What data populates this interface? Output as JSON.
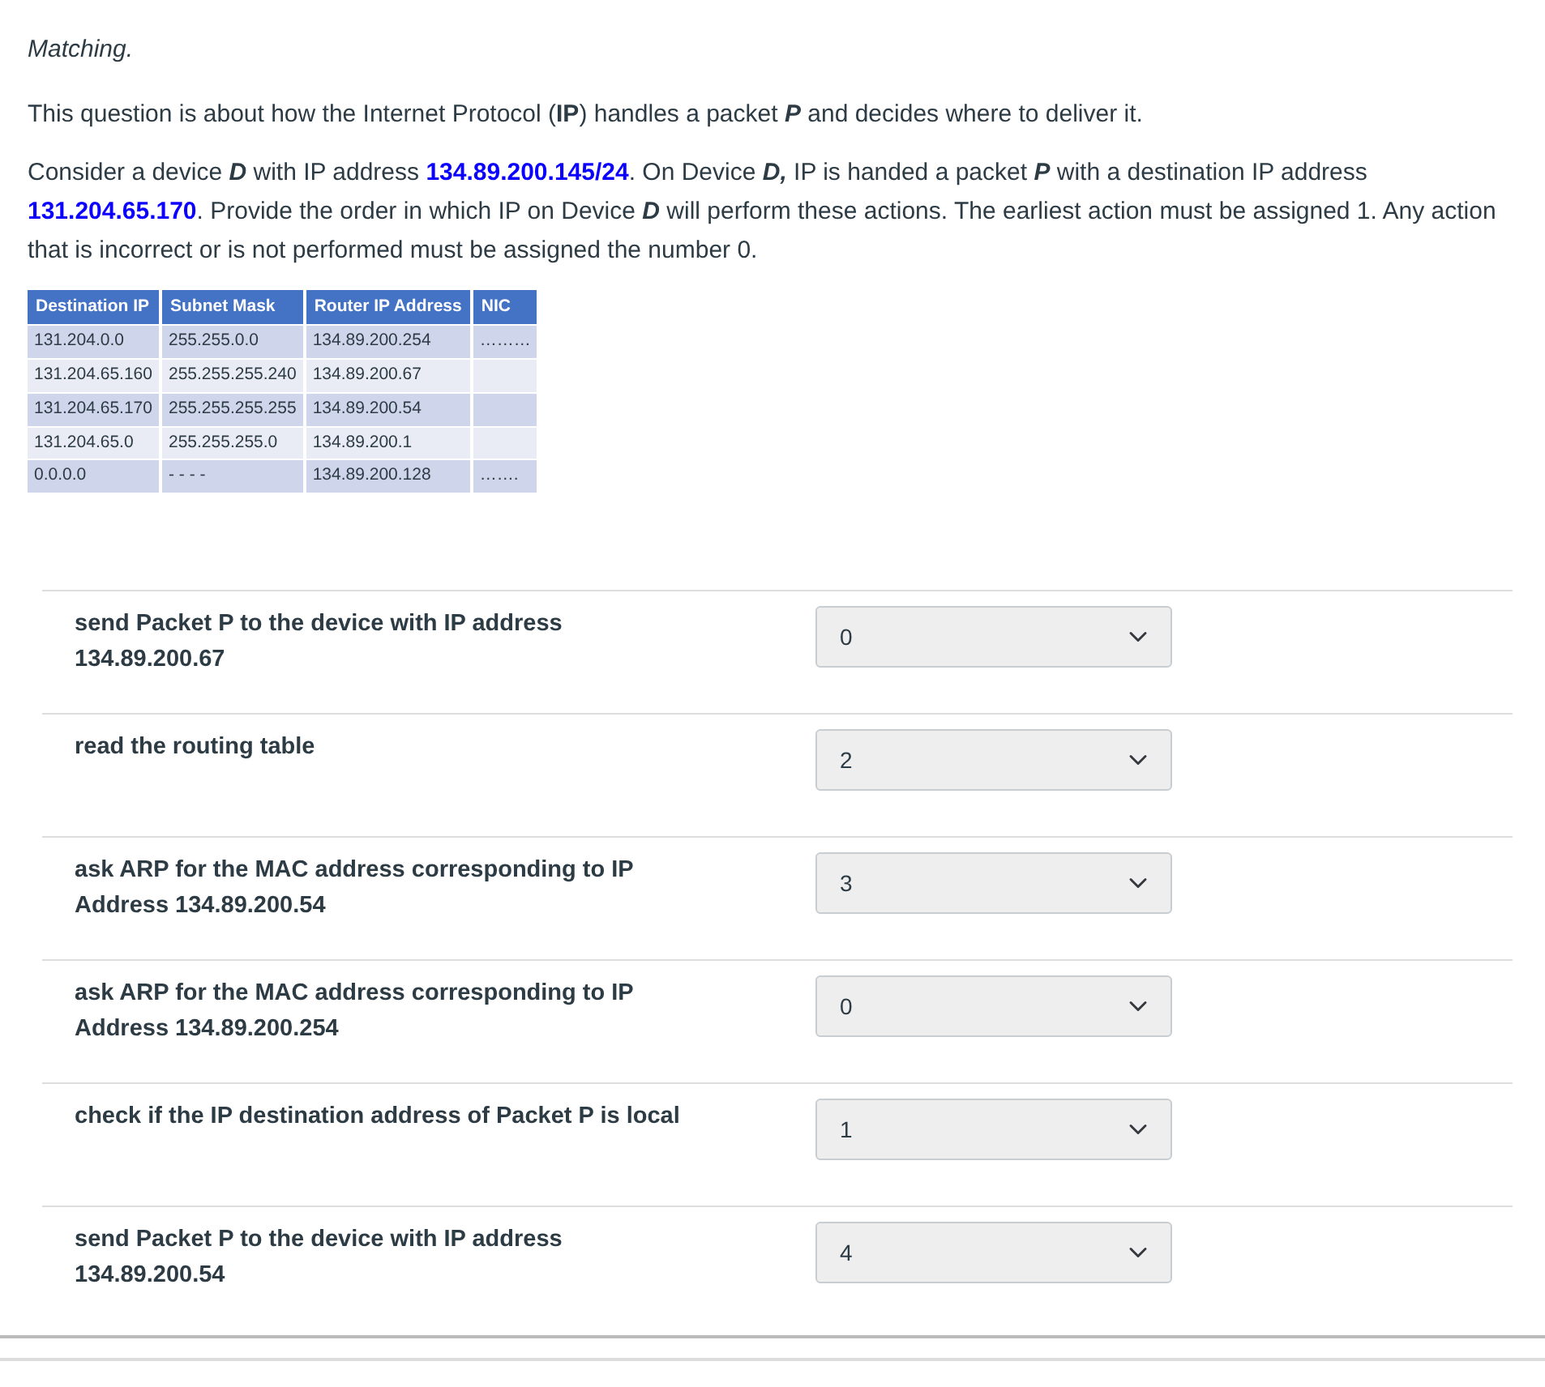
{
  "question_type": "Matching.",
  "intro": [
    {
      "kind": "text",
      "text": "This question is about how the Internet Protocol ("
    },
    {
      "kind": "strong",
      "text": "IP"
    },
    {
      "kind": "text",
      "text": ") handles a packet "
    },
    {
      "kind": "em",
      "text": "P"
    },
    {
      "kind": "text",
      "text": " and decides where to deliver it."
    }
  ],
  "instructions": [
    {
      "kind": "text",
      "text": "Consider a device "
    },
    {
      "kind": "em",
      "text": "D"
    },
    {
      "kind": "text",
      "text": " with IP address "
    },
    {
      "kind": "ip",
      "text": "134.89.200.145/24"
    },
    {
      "kind": "text",
      "text": ". On Device "
    },
    {
      "kind": "em",
      "text": "D,"
    },
    {
      "kind": "text",
      "text": " IP is handed a packet "
    },
    {
      "kind": "em",
      "text": "P"
    },
    {
      "kind": "text",
      "text": " with a destination IP address "
    },
    {
      "kind": "ip",
      "text": "131.204.65.170"
    },
    {
      "kind": "text",
      "text": ". Provide the order in which IP on Device "
    },
    {
      "kind": "em",
      "text": "D"
    },
    {
      "kind": "text",
      "text": " will perform these actions. The earliest action must be assigned 1. Any action that is incorrect or is not performed must be assigned the number 0."
    }
  ],
  "routing_table": {
    "columns": [
      "Destination IP",
      "Subnet Mask",
      "Router IP Address",
      "NIC"
    ],
    "rows": [
      [
        "131.204.0.0",
        "255.255.0.0",
        "134.89.200.254",
        "………"
      ],
      [
        "131.204.65.160",
        "255.255.255.240",
        "134.89.200.67",
        ""
      ],
      [
        "131.204.65.170",
        "255.255.255.255",
        "134.89.200.54",
        ""
      ],
      [
        "131.204.65.0",
        "255.255.255.0",
        "134.89.200.1",
        ""
      ],
      [
        "0.0.0.0",
        "- - - -",
        "134.89.200.128",
        "……."
      ]
    ]
  },
  "matches": [
    {
      "prompt": "send Packet P to the device with IP address 134.89.200.67",
      "answer": "0"
    },
    {
      "prompt": "read the routing table",
      "answer": "2"
    },
    {
      "prompt": "ask ARP for the MAC address corresponding to IP Address 134.89.200.54",
      "answer": "3"
    },
    {
      "prompt": "ask ARP for the MAC address corresponding to IP Address 134.89.200.254",
      "answer": "0"
    },
    {
      "prompt": "check if the IP destination address of Packet P is local",
      "answer": "1"
    },
    {
      "prompt": "send Packet P to the device with IP address 134.89.200.54",
      "answer": "4"
    }
  ]
}
